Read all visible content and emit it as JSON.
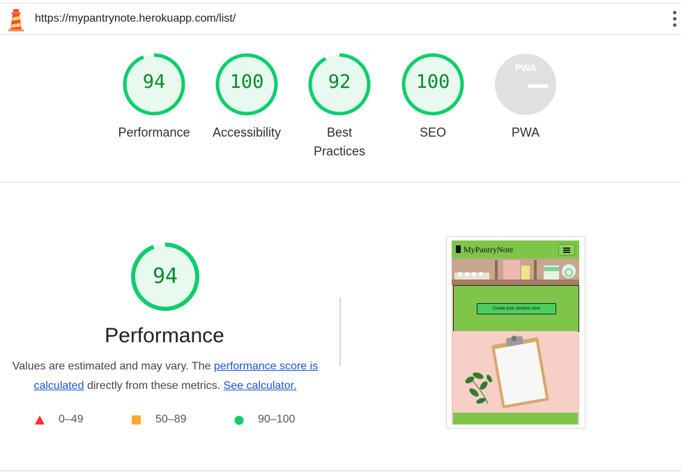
{
  "browser": {
    "url": "https://mypantrynote.herokuapp.com/list/"
  },
  "categories": [
    {
      "label": "Performance",
      "score": "94",
      "value": 94
    },
    {
      "label": "Accessibility",
      "score": "100",
      "value": 100
    },
    {
      "label": "Best Practices",
      "score": "92",
      "value": 92
    },
    {
      "label": "SEO",
      "score": "100",
      "value": 100
    },
    {
      "label": "PWA",
      "badge": "PWA"
    }
  ],
  "performance": {
    "score": "94",
    "value": 94,
    "title": "Performance",
    "desc_prefix": "Values are estimated and may vary. The ",
    "link_score": "performance score is calculated",
    "desc_mid": " directly from these metrics. ",
    "link_calc": "See calculator.",
    "legend": [
      {
        "range": "0–49",
        "color": "#ff3333",
        "shape": "triangle"
      },
      {
        "range": "50–89",
        "color": "#ffaa33",
        "shape": "square"
      },
      {
        "range": "90–100",
        "color": "#0cce6b",
        "shape": "circle"
      }
    ]
  },
  "screenshot": {
    "brand": "MyPantryNote",
    "cta": "Create your stocklist now!"
  },
  "colors": {
    "pass_ring": "#0cce6b",
    "pass_fill": "#e8faef",
    "pass_text": "#0a8a2e",
    "pwa_gray": "#e0e0e0",
    "app_green": "#7ec54a"
  }
}
